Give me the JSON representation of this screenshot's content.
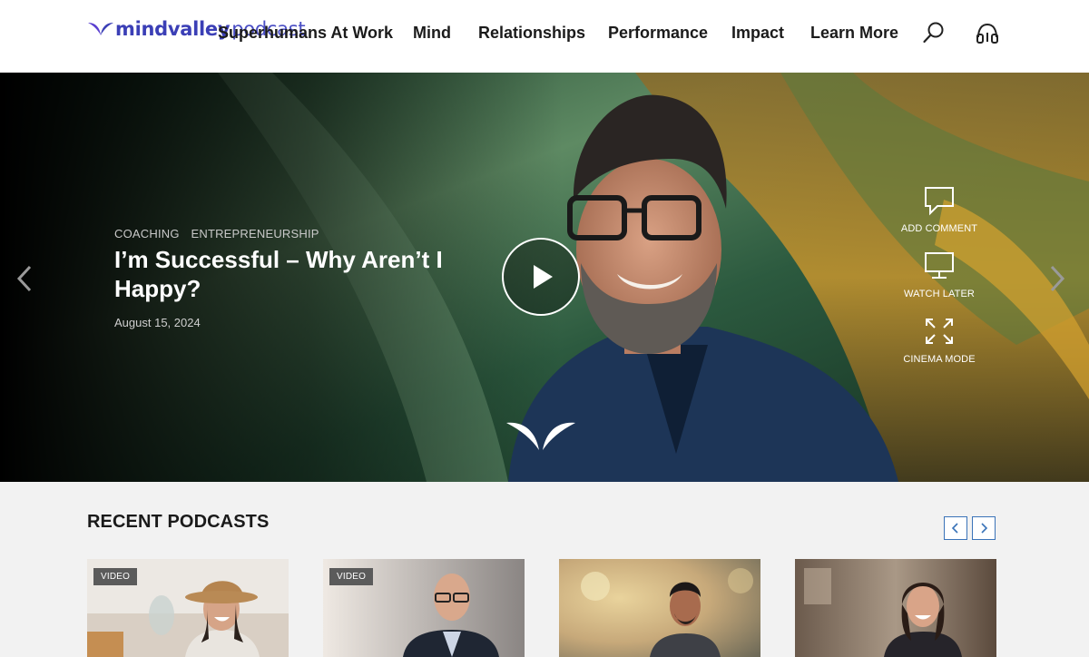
{
  "brand": {
    "name": "mindvalley",
    "sub": "podcast"
  },
  "nav": {
    "items": [
      "Superhumans At Work",
      "Mind",
      "Relationships",
      "Performance",
      "Impact",
      "Learn More"
    ],
    "search_icon": "search-icon",
    "podcast_icon": "headphones-icon"
  },
  "hero": {
    "categories": [
      "COACHING",
      "ENTREPRENEURSHIP"
    ],
    "title": "I’m Successful – Why Aren’t I Happy?",
    "date": "August 15, 2024",
    "actions": [
      {
        "label": "ADD COMMENT",
        "icon": "comment-icon"
      },
      {
        "label": "WATCH LATER",
        "icon": "monitor-icon"
      },
      {
        "label": "CINEMA MODE",
        "icon": "expand-icon"
      }
    ]
  },
  "recent": {
    "title": "RECENT PODCASTS",
    "cards": [
      {
        "badge": "VIDEO"
      },
      {
        "badge": "VIDEO"
      },
      {
        "badge": ""
      },
      {
        "badge": ""
      }
    ]
  },
  "colors": {
    "brand": "#3b3fb6",
    "accent_border": "#3a73b8"
  }
}
